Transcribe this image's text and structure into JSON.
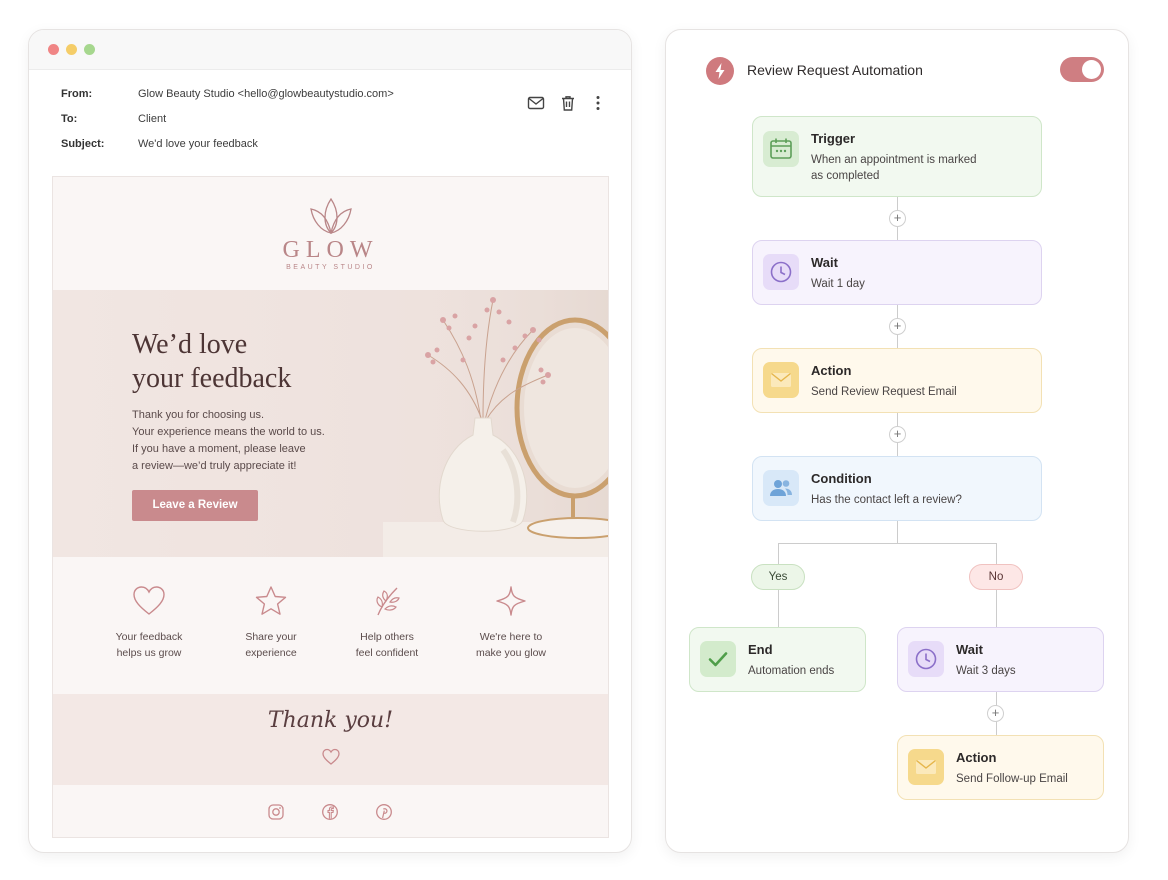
{
  "email": {
    "headers": {
      "from_key": "From:",
      "from_val": "Glow Beauty Studio <hello@glowbeautystudio.com>",
      "to_key": "To:",
      "to_val": "Client",
      "subject_key": "Subject:",
      "subject_val": "We'd love your feedback"
    },
    "actions": [
      "mail-icon",
      "trash-icon",
      "more-vertical-icon"
    ],
    "logo": {
      "word": "GLOW",
      "sub": "BEAUTY STUDIO"
    },
    "hero": {
      "title_line1": "We’d love",
      "title_line2": "your feedback",
      "text_line1": "Thank you for choosing us.",
      "text_line2": "Your experience means the world to us.",
      "text_line3": "If you have a moment, please leave",
      "text_line4": "a review—we’d truly appreciate it!",
      "button": "Leave a Review"
    },
    "features": [
      {
        "icon": "heart-icon",
        "line1": "Your feedback",
        "line2": "helps us grow"
      },
      {
        "icon": "star-icon",
        "line1": "Share your",
        "line2": "experience"
      },
      {
        "icon": "leaf-icon",
        "line1": "Help others",
        "line2": "feel confident"
      },
      {
        "icon": "sparkle-icon",
        "line1": "We're here to",
        "line2": "make you glow"
      }
    ],
    "thanks": "Thank you!",
    "social": [
      "instagram-icon",
      "facebook-icon",
      "pinterest-icon"
    ]
  },
  "automation": {
    "title": "Review Request Automation",
    "enabled": true,
    "colors": {
      "accent": "#cf7a7e",
      "green": "#6fb16a",
      "purple": "#8b6fc9",
      "yellow": "#f2c15b",
      "blue": "#6ea3d8"
    },
    "nodes": {
      "trigger": {
        "title": "Trigger",
        "line1": "When an appointment is marked",
        "line2": "as completed",
        "icon": "calendar-icon"
      },
      "wait1": {
        "title": "Wait",
        "text": "Wait 1 day",
        "icon": "clock-icon"
      },
      "action1": {
        "title": "Action",
        "text": "Send Review Request Email",
        "icon": "envelope-icon"
      },
      "condition": {
        "title": "Condition",
        "text": "Has the contact left a review?",
        "icon": "users-icon"
      },
      "end": {
        "title": "End",
        "text": "Automation ends",
        "icon": "check-icon"
      },
      "wait2": {
        "title": "Wait",
        "text": "Wait 3 days",
        "icon": "clock-icon"
      },
      "action2": {
        "title": "Action",
        "text": "Send Follow-up Email",
        "icon": "envelope-icon"
      }
    },
    "branches": {
      "yes": "Yes",
      "no": "No"
    },
    "plus": "+"
  }
}
